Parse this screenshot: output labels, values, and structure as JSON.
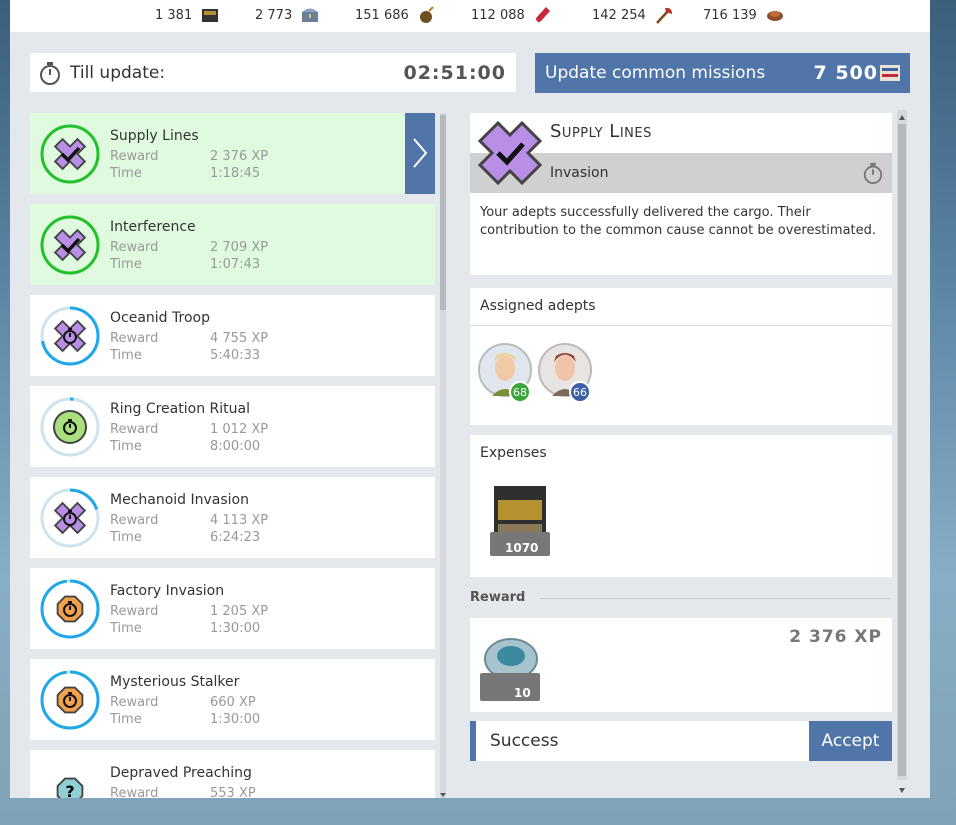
{
  "resources": [
    {
      "value": "1 381",
      "icon": "ammo-crate-icon"
    },
    {
      "value": "2 773",
      "icon": "treasure-chest-icon"
    },
    {
      "value": "151 686",
      "icon": "bomb-icon"
    },
    {
      "value": "112 088",
      "icon": "potion-vial-icon"
    },
    {
      "value": "142 254",
      "icon": "axe-icon"
    },
    {
      "value": "716 139",
      "icon": "shell-icon"
    }
  ],
  "timer": {
    "label": "Till update:",
    "value": "02:51:00"
  },
  "update": {
    "label": "Update common missions",
    "cost": "7 500"
  },
  "missions": [
    {
      "name": "Supply Lines",
      "reward_label": "Reward",
      "reward": "2 376 XP",
      "time_label": "Time",
      "time": "1:18:45",
      "status": "done",
      "badge": "purple"
    },
    {
      "name": "Interference",
      "reward_label": "Reward",
      "reward": "2 709 XP",
      "time_label": "Time",
      "time": "1:07:43",
      "status": "done",
      "badge": "purple"
    },
    {
      "name": "Oceanid Troop",
      "reward_label": "Reward",
      "reward": "4 755 XP",
      "time_label": "Time",
      "time": "5:40:33",
      "status": "progress",
      "badge": "purple",
      "progress": 0.72
    },
    {
      "name": "Ring Creation Ritual",
      "reward_label": "Reward",
      "reward": "1 012 XP",
      "time_label": "Time",
      "time": "8:00:00",
      "status": "progress",
      "badge": "green",
      "progress": 0.02
    },
    {
      "name": "Mechanoid Invasion",
      "reward_label": "Reward",
      "reward": "4 113 XP",
      "time_label": "Time",
      "time": "6:24:23",
      "status": "progress",
      "badge": "purple",
      "progress": 0.2
    },
    {
      "name": "Factory Invasion",
      "reward_label": "Reward",
      "reward": "1 205 XP",
      "time_label": "Time",
      "time": "1:30:00",
      "status": "progress",
      "badge": "orange",
      "progress": 0.98
    },
    {
      "name": "Mysterious Stalker",
      "reward_label": "Reward",
      "reward": "660 XP",
      "time_label": "Time",
      "time": "1:30:00",
      "status": "progress",
      "badge": "orange",
      "progress": 0.98
    },
    {
      "name": "Depraved Preaching",
      "reward_label": "Reward",
      "reward": "553 XP",
      "time_label": "Time",
      "time": "",
      "status": "unknown",
      "badge": "teal"
    }
  ],
  "detail": {
    "title": "Supply Lines",
    "subtitle": "Invasion",
    "description": "Your adepts successfully delivered the cargo. Their contribution to the common cause cannot be overestimated.",
    "assigned_label": "Assigned adepts",
    "adepts": [
      {
        "level": "68",
        "color": "#3aa53a"
      },
      {
        "level": "66",
        "color": "#3e5fa8"
      }
    ],
    "expenses_label": "Expenses",
    "expense_count": "1070",
    "reward_label": "Reward",
    "reward_count": "10",
    "reward_xp": "2 376 XP",
    "status": "Success",
    "accept": "Accept"
  },
  "colors": {
    "accent": "#4f75a9",
    "done_bg": "#dffadf",
    "done_ring": "#22c02a",
    "progress_ring": "#1fa7e8"
  }
}
